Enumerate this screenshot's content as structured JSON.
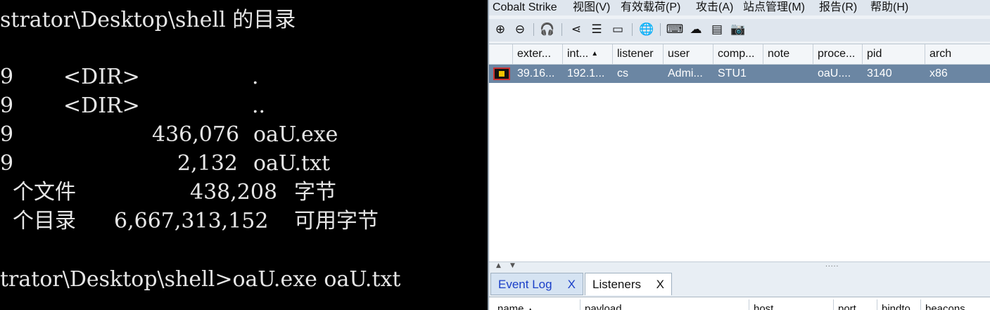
{
  "console": {
    "lines": [
      "strator\\Desktop\\shell 的目录",
      "",
      "9    <DIR>          .",
      "9    <DIR>          ..",
      "9           436,076 oaU.exe",
      "9             2,132 oaU.txt",
      " 个文件         438,208 字节",
      " 个目录  6,667,313,152 可用字节",
      "",
      "trator\\Desktop\\shell>oaU.exe oaU.txt"
    ]
  },
  "cobalt": {
    "menu": [
      "Cobalt Strike",
      "视图(V)",
      "有效载荷(P)",
      "攻击(A)",
      "站点管理(M)",
      "报告(R)",
      "帮助(H)"
    ],
    "toolbar_icons": [
      {
        "name": "new-connection-icon",
        "glyph": "⊕"
      },
      {
        "name": "disconnect-icon",
        "glyph": "⊖"
      },
      {
        "name": "headphones-icon",
        "glyph": "🎧"
      },
      {
        "name": "pivot-graph-icon",
        "glyph": "⋖"
      },
      {
        "name": "session-table-icon",
        "glyph": "☰"
      },
      {
        "name": "target-table-icon",
        "glyph": "▭"
      },
      {
        "name": "web-log-icon",
        "glyph": "🌐"
      },
      {
        "name": "keystrokes-icon",
        "glyph": "⌨"
      },
      {
        "name": "downloads-icon",
        "glyph": "☁"
      },
      {
        "name": "credentials-icon",
        "glyph": "▤"
      },
      {
        "name": "screenshot-icon",
        "glyph": "📷"
      }
    ],
    "table": {
      "columns": [
        "exter...",
        "int...",
        "listener",
        "user",
        "comp...",
        "note",
        "proce...",
        "pid",
        "arch"
      ],
      "sort_indicator": "▲",
      "rows": [
        {
          "external": "39.16...",
          "internal": "192.1...",
          "listener": "cs",
          "user": "Admi...",
          "computer": "STU1",
          "note": "",
          "process": "oaU....",
          "pid": "3140",
          "arch": "x86"
        }
      ]
    },
    "splitter": {
      "up": "▲",
      "down": "▼",
      "grip": "....."
    },
    "tabs": [
      {
        "label": "Event Log",
        "close": "X",
        "active": false
      },
      {
        "label": "Listeners",
        "close": "X",
        "active": true
      }
    ],
    "listener_columns": [
      "name",
      "payload",
      "host",
      "port",
      "bindto",
      "beacons"
    ],
    "listener_sort_indicator": "▲"
  }
}
